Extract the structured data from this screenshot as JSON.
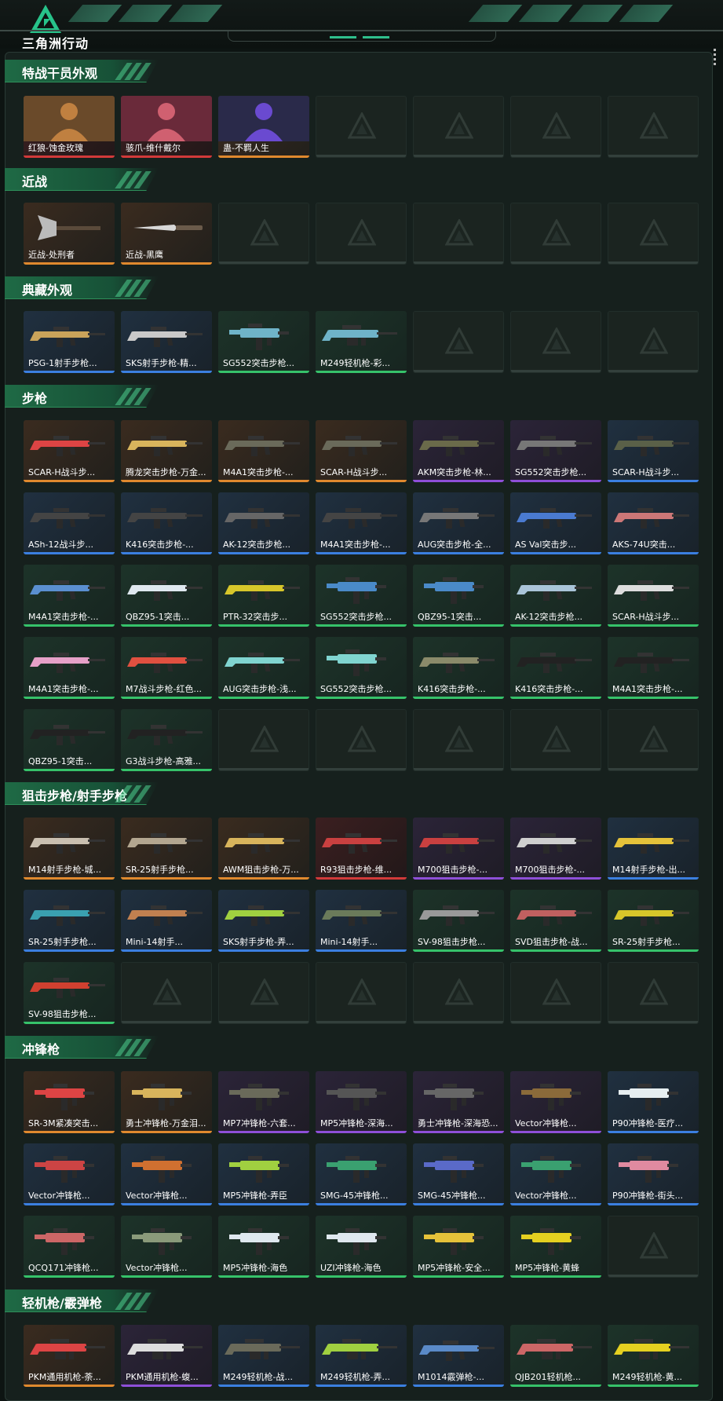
{
  "app": {
    "brand": "三角洲行动"
  },
  "sections": [
    {
      "title": "特战干员外观",
      "items": [
        {
          "label": "红狼-蚀金玫瑰",
          "rarity": "red",
          "kind": "operator",
          "overlay": "蚀金玫瑰"
        },
        {
          "label": "骇爪-维什戴尔",
          "rarity": "red",
          "kind": "operator",
          "overlay": "维什戴尔"
        },
        {
          "label": "蛊-不羁人生",
          "rarity": "orange",
          "kind": "operator",
          "overlay": ""
        },
        {
          "empty": true
        },
        {
          "empty": true
        },
        {
          "empty": true
        },
        {
          "empty": true
        }
      ]
    },
    {
      "title": "近战",
      "items": [
        {
          "label": "近战-处刑者",
          "rarity": "orange",
          "kind": "melee-axe"
        },
        {
          "label": "近战-黑鹰",
          "rarity": "orange",
          "kind": "melee-knife"
        },
        {
          "empty": true
        },
        {
          "empty": true
        },
        {
          "empty": true
        },
        {
          "empty": true
        },
        {
          "empty": true
        }
      ]
    },
    {
      "title": "典藏外观",
      "items": [
        {
          "label": "PSG-1射手步枪...",
          "rarity": "blue",
          "kind": "rifle",
          "color": "#c9a35a"
        },
        {
          "label": "SKS射手步枪-精...",
          "rarity": "blue",
          "kind": "rifle",
          "color": "#c9c9c9"
        },
        {
          "label": "SG552突击步枪...",
          "rarity": "green",
          "kind": "smg",
          "color": "#6fb3c8"
        },
        {
          "label": "M249轻机枪-彩...",
          "rarity": "green",
          "kind": "lmg",
          "color": "#6fb3c8"
        },
        {
          "empty": true
        },
        {
          "empty": true
        },
        {
          "empty": true
        }
      ]
    },
    {
      "title": "步枪",
      "items": [
        {
          "label": "SCAR-H战斗步...",
          "rarity": "orange",
          "kind": "rifle",
          "color": "#d44"
        },
        {
          "label": "腾龙突击步枪-万金...",
          "rarity": "orange",
          "kind": "rifle",
          "color": "#d8b45c"
        },
        {
          "label": "M4A1突击步枪-...",
          "rarity": "orange",
          "kind": "rifle",
          "color": "#6a6a5a"
        },
        {
          "label": "SCAR-H战斗步...",
          "rarity": "orange",
          "kind": "rifle",
          "color": "#6a6a5a"
        },
        {
          "label": "AKM突击步枪-林...",
          "rarity": "purple",
          "kind": "rifle",
          "color": "#6a6a4a"
        },
        {
          "label": "SG552突击步枪...",
          "rarity": "purple",
          "kind": "rifle",
          "color": "#777"
        },
        {
          "label": "SCAR-H战斗步...",
          "rarity": "blue",
          "kind": "rifle",
          "color": "#5a6048"
        },
        {
          "label": "ASh-12战斗步...",
          "rarity": "blue",
          "kind": "rifle",
          "color": "#444"
        },
        {
          "label": "K416突击步枪-...",
          "rarity": "blue",
          "kind": "rifle",
          "color": "#444"
        },
        {
          "label": "AK-12突击步枪...",
          "rarity": "blue",
          "kind": "rifle",
          "color": "#666"
        },
        {
          "label": "M4A1突击步枪-...",
          "rarity": "blue",
          "kind": "rifle",
          "color": "#444"
        },
        {
          "label": "AUG突击步枪-全...",
          "rarity": "blue",
          "kind": "rifle",
          "color": "#777"
        },
        {
          "label": "AS Val突击步...",
          "rarity": "blue",
          "kind": "rifle",
          "color": "#4a7ad0"
        },
        {
          "label": "AKS-74U突击...",
          "rarity": "blue",
          "kind": "rifle",
          "color": "#c77"
        },
        {
          "label": "M4A1突击步枪-...",
          "rarity": "green",
          "kind": "rifle",
          "color": "#5a8fd0"
        },
        {
          "label": "QBZ95-1突击...",
          "rarity": "green",
          "kind": "rifle",
          "color": "#dfe8ef"
        },
        {
          "label": "PTR-32突击步...",
          "rarity": "green",
          "kind": "rifle",
          "color": "#d7c62a"
        },
        {
          "label": "SG552突击步枪...",
          "rarity": "green",
          "kind": "smg",
          "color": "#4a8ac8"
        },
        {
          "label": "QBZ95-1突击...",
          "rarity": "green",
          "kind": "smg",
          "color": "#4a8ac8"
        },
        {
          "label": "AK-12突击步枪...",
          "rarity": "green",
          "kind": "rifle",
          "color": "#a9c4d8"
        },
        {
          "label": "SCAR-H战斗步...",
          "rarity": "green",
          "kind": "rifle",
          "color": "#ddd"
        },
        {
          "label": "M4A1突击步枪-...",
          "rarity": "green",
          "kind": "rifle",
          "color": "#e6a0c8"
        },
        {
          "label": "M7战斗步枪-红色...",
          "rarity": "green",
          "kind": "rifle",
          "color": "#e05040"
        },
        {
          "label": "AUG突击步枪-浅...",
          "rarity": "green",
          "kind": "rifle",
          "color": "#80d4d0"
        },
        {
          "label": "SG552突击步枪...",
          "rarity": "green",
          "kind": "smg",
          "color": "#80d4d0"
        },
        {
          "label": "K416突击步枪-...",
          "rarity": "green",
          "kind": "rifle",
          "color": "#8a8a6a"
        },
        {
          "label": "K416突击步枪-...",
          "rarity": "green",
          "kind": "rifle",
          "color": "#222"
        },
        {
          "label": "M4A1突击步枪-...",
          "rarity": "green",
          "kind": "rifle",
          "color": "#222"
        },
        {
          "label": "QBZ95-1突击...",
          "rarity": "green",
          "kind": "rifle",
          "color": "#222"
        },
        {
          "label": "G3战斗步枪-高雅...",
          "rarity": "green",
          "kind": "rifle",
          "color": "#222"
        },
        {
          "empty": true
        },
        {
          "empty": true
        },
        {
          "empty": true
        },
        {
          "empty": true
        },
        {
          "empty": true
        }
      ]
    },
    {
      "title": "狙击步枪/射手步枪",
      "items": [
        {
          "label": "M14射手步枪-城...",
          "rarity": "orange",
          "kind": "rifle",
          "color": "#c9bfb0"
        },
        {
          "label": "SR-25射手步枪...",
          "rarity": "orange",
          "kind": "rifle",
          "color": "#b3a690"
        },
        {
          "label": "AWM狙击步枪-万...",
          "rarity": "orange",
          "kind": "rifle",
          "color": "#d8b45c"
        },
        {
          "label": "R93狙击步枪-维...",
          "rarity": "red",
          "kind": "rifle",
          "color": "#c94040"
        },
        {
          "label": "M700狙击步枪-...",
          "rarity": "purple",
          "kind": "rifle",
          "color": "#c94040"
        },
        {
          "label": "M700狙击步枪-...",
          "rarity": "purple",
          "kind": "rifle",
          "color": "#cfcfcf"
        },
        {
          "label": "M14射手步枪-出...",
          "rarity": "blue",
          "kind": "rifle",
          "color": "#e5c23a"
        },
        {
          "label": "SR-25射手步枪...",
          "rarity": "blue",
          "kind": "rifle",
          "color": "#3aa0b0"
        },
        {
          "label": "Mini-14射手...",
          "rarity": "blue",
          "kind": "rifle",
          "color": "#c08050"
        },
        {
          "label": "SKS射手步枪-弄...",
          "rarity": "blue",
          "kind": "rifle",
          "color": "#a0d040"
        },
        {
          "label": "Mini-14射手...",
          "rarity": "blue",
          "kind": "rifle",
          "color": "#6a7a5a"
        },
        {
          "label": "SV-98狙击步枪...",
          "rarity": "green",
          "kind": "rifle",
          "color": "#999"
        },
        {
          "label": "SVD狙击步枪-战...",
          "rarity": "green",
          "kind": "rifle",
          "color": "#c06060"
        },
        {
          "label": "SR-25射手步枪...",
          "rarity": "green",
          "kind": "rifle",
          "color": "#d7c62a"
        },
        {
          "label": "SV-98狙击步枪...",
          "rarity": "green",
          "kind": "rifle",
          "color": "#d04030"
        },
        {
          "empty": true
        },
        {
          "empty": true
        },
        {
          "empty": true
        },
        {
          "empty": true
        },
        {
          "empty": true
        },
        {
          "empty": true
        }
      ]
    },
    {
      "title": "冲锋枪",
      "items": [
        {
          "label": "SR-3M紧凑突击...",
          "rarity": "orange",
          "kind": "smg",
          "color": "#d44"
        },
        {
          "label": "勇士冲锋枪-万金泪...",
          "rarity": "orange",
          "kind": "smg",
          "color": "#d8b45c"
        },
        {
          "label": "MP7冲锋枪-六套...",
          "rarity": "purple",
          "kind": "smg",
          "color": "#6a6a5a"
        },
        {
          "label": "MP5冲锋枪-深海...",
          "rarity": "purple",
          "kind": "smg",
          "color": "#555"
        },
        {
          "label": "勇士冲锋枪-深海恐...",
          "rarity": "purple",
          "kind": "smg",
          "color": "#666"
        },
        {
          "label": "Vector冲锋枪...",
          "rarity": "purple",
          "kind": "smg",
          "color": "#8a6a3a"
        },
        {
          "label": "P90冲锋枪-医疗...",
          "rarity": "blue",
          "kind": "smg",
          "color": "#e6eef0"
        },
        {
          "label": "Vector冲锋枪...",
          "rarity": "blue",
          "kind": "smg",
          "color": "#c44"
        },
        {
          "label": "Vector冲锋枪...",
          "rarity": "blue",
          "kind": "smg",
          "color": "#d07030"
        },
        {
          "label": "MP5冲锋枪-弄臣",
          "rarity": "blue",
          "kind": "smg",
          "color": "#a0d040"
        },
        {
          "label": "SMG-45冲锋枪...",
          "rarity": "blue",
          "kind": "smg",
          "color": "#3aa070"
        },
        {
          "label": "SMG-45冲锋枪...",
          "rarity": "blue",
          "kind": "smg",
          "color": "#5a6ac8"
        },
        {
          "label": "Vector冲锋枪...",
          "rarity": "blue",
          "kind": "smg",
          "color": "#3aa070"
        },
        {
          "label": "P90冲锋枪-街头...",
          "rarity": "blue",
          "kind": "smg",
          "color": "#e08aa0"
        },
        {
          "label": "QCQ171冲锋枪...",
          "rarity": "green",
          "kind": "smg",
          "color": "#c66"
        },
        {
          "label": "Vector冲锋枪...",
          "rarity": "green",
          "kind": "smg",
          "color": "#8a9a7a"
        },
        {
          "label": "MP5冲锋枪-海色",
          "rarity": "green",
          "kind": "smg",
          "color": "#dfe8ef"
        },
        {
          "label": "UZI冲锋枪-海色",
          "rarity": "green",
          "kind": "smg",
          "color": "#dfe8ef"
        },
        {
          "label": "MP5冲锋枪-安全...",
          "rarity": "green",
          "kind": "smg",
          "color": "#e5c23a"
        },
        {
          "label": "MP5冲锋枪-黄蜂",
          "rarity": "green",
          "kind": "smg",
          "color": "#e5d020"
        },
        {
          "empty": true
        }
      ]
    },
    {
      "title": "轻机枪/霰弹枪",
      "items": [
        {
          "label": "PKM通用机枪-荼...",
          "rarity": "orange",
          "kind": "lmg",
          "color": "#d44"
        },
        {
          "label": "PKM通用机枪-蝮...",
          "rarity": "purple",
          "kind": "lmg",
          "color": "#ddd"
        },
        {
          "label": "M249轻机枪-战...",
          "rarity": "blue",
          "kind": "lmg",
          "color": "#6a6a5a"
        },
        {
          "label": "M249轻机枪-弄...",
          "rarity": "blue",
          "kind": "lmg",
          "color": "#a0d040"
        },
        {
          "label": "M1014霰弹枪-...",
          "rarity": "blue",
          "kind": "rifle",
          "color": "#5a8ac8"
        },
        {
          "label": "QJB201轻机枪...",
          "rarity": "green",
          "kind": "lmg",
          "color": "#c66"
        },
        {
          "label": "M249轻机枪-黄...",
          "rarity": "green",
          "kind": "lmg",
          "color": "#e5d020"
        }
      ]
    }
  ]
}
